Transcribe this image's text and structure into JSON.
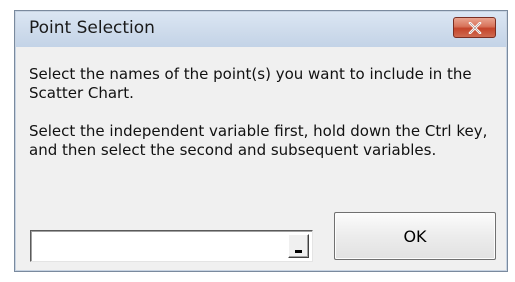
{
  "window": {
    "title": "Point Selection",
    "close_icon": "close-icon"
  },
  "instructions": {
    "line1": "Select the names of the point(s) you want to include in the Scatter Chart.",
    "line2": "Select the independent variable first, hold down the Ctrl key, and then select the second and subsequent variables."
  },
  "range_input": {
    "value": "",
    "collapse_icon": "collapse-dialog-icon"
  },
  "buttons": {
    "ok_label": "OK"
  },
  "colors": {
    "close_button": "#c4442a",
    "titlebar": "#cfdcec",
    "dialog_body": "#f0f0f0"
  }
}
